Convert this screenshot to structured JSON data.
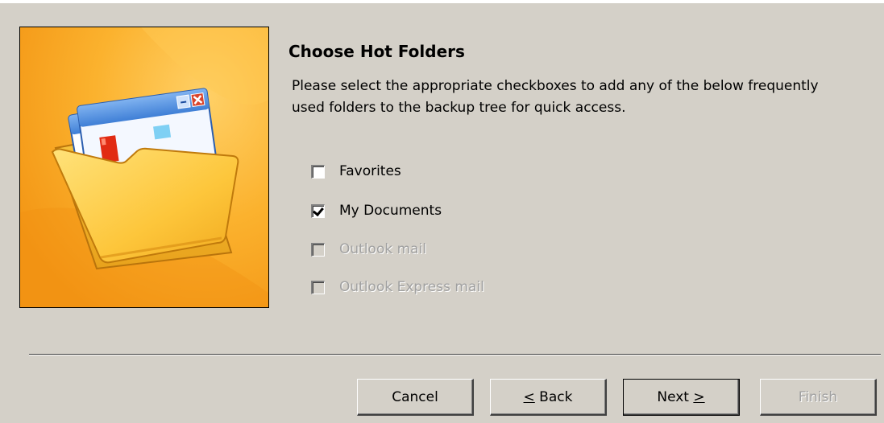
{
  "header": {
    "title": "Choose Hot Folders",
    "description": "Please select the appropriate checkboxes to add any of the below frequently used folders to the backup tree for quick access."
  },
  "illustration": {
    "icon": "folder-with-windows-icon"
  },
  "options": [
    {
      "label": "Favorites",
      "checked": false,
      "enabled": true
    },
    {
      "label": "My Documents",
      "checked": true,
      "enabled": true
    },
    {
      "label": "Outlook mail",
      "checked": false,
      "enabled": false
    },
    {
      "label": "Outlook Express mail",
      "checked": false,
      "enabled": false
    }
  ],
  "buttons": {
    "cancel": "Cancel",
    "back_prefix": "<",
    "back_suffix": " Back",
    "next_prefix": "Next ",
    "next_suffix": ">",
    "finish": "Finish"
  },
  "colors": {
    "dialog_bg": "#d4d0c8",
    "illustration_bg": "#f7a21d",
    "folder": "#fbc53a",
    "disabled_text": "#a0a0a0"
  }
}
